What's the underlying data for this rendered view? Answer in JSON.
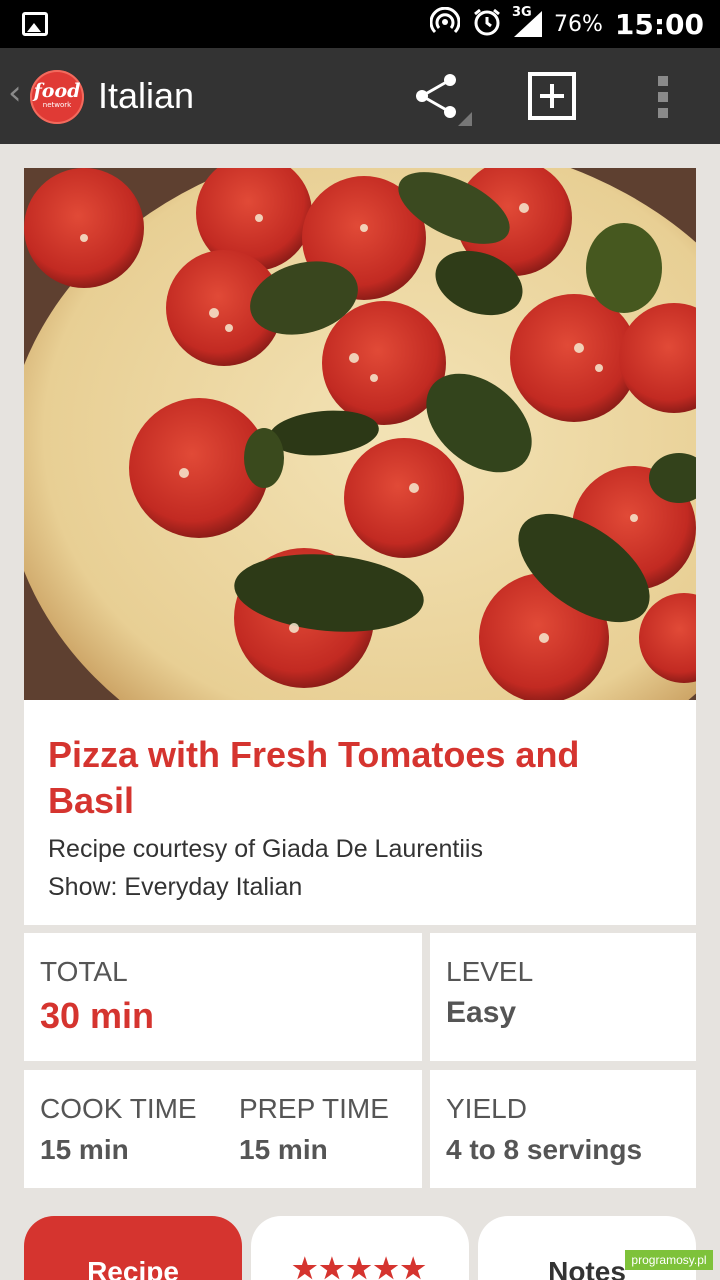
{
  "status_bar": {
    "network": "3G",
    "battery": "76%",
    "time": "15:00"
  },
  "app_bar": {
    "title": "Italian",
    "logo_text": "food",
    "logo_subtext": "network"
  },
  "recipe": {
    "title": "Pizza with Fresh Tomatoes and Basil",
    "courtesy": "Recipe courtesy of Giada De Laurentiis",
    "show": "Show: Everyday Italian"
  },
  "info": {
    "total_label": "TOTAL",
    "total_value": "30 min",
    "level_label": "LEVEL",
    "level_value": "Easy",
    "cook_label": "COOK TIME",
    "cook_value": "15 min",
    "prep_label": "PREP TIME",
    "prep_value": "15 min",
    "yield_label": "YIELD",
    "yield_value": "4 to 8 servings"
  },
  "tabs": {
    "recipe": "Recipe",
    "reviews_stars": "★★★★★",
    "notes": "Notes"
  },
  "watermark": "programosy.pl",
  "colors": {
    "accent": "#d5342f",
    "app_bar": "#333333",
    "background": "#e6e3df"
  }
}
